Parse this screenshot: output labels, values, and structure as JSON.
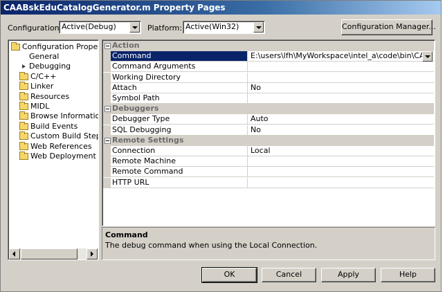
{
  "window": {
    "title": "CAABskEduCatalogGenerator.m Property Pages"
  },
  "toolbar": {
    "configuration_label": "Configuration:",
    "configuration_value": "Active(Debug)",
    "platform_label": "Platform:",
    "platform_value": "Active(Win32)",
    "config_manager_button": "Configuration Manager..."
  },
  "tree": {
    "root": "Configuration Properties",
    "items": [
      {
        "label": "General",
        "icon": "none"
      },
      {
        "label": "Debugging",
        "icon": "arrow-icon"
      },
      {
        "label": "C/C++",
        "icon": "folder-icon"
      },
      {
        "label": "Linker",
        "icon": "folder-icon"
      },
      {
        "label": "Resources",
        "icon": "folder-icon"
      },
      {
        "label": "MIDL",
        "icon": "folder-icon"
      },
      {
        "label": "Browse Information",
        "icon": "folder-icon"
      },
      {
        "label": "Build Events",
        "icon": "folder-icon"
      },
      {
        "label": "Custom Build Step",
        "icon": "folder-icon"
      },
      {
        "label": "Web References",
        "icon": "folder-icon"
      },
      {
        "label": "Web Deployment",
        "icon": "folder-icon"
      }
    ]
  },
  "grid": {
    "categories": [
      {
        "name": "Action",
        "properties": [
          {
            "name": "Command",
            "value": "E:\\users\\lfh\\MyWorkspace\\intel_a\\code\\bin\\CAABskEdu"
          },
          {
            "name": "Command Arguments",
            "value": ""
          },
          {
            "name": "Working Directory",
            "value": ""
          },
          {
            "name": "Attach",
            "value": "No"
          },
          {
            "name": "Symbol Path",
            "value": ""
          }
        ]
      },
      {
        "name": "Debuggers",
        "properties": [
          {
            "name": "Debugger Type",
            "value": "Auto"
          },
          {
            "name": "SQL Debugging",
            "value": "No"
          }
        ]
      },
      {
        "name": "Remote Settings",
        "properties": [
          {
            "name": "Connection",
            "value": "Local"
          },
          {
            "name": "Remote Machine",
            "value": ""
          },
          {
            "name": "Remote Command",
            "value": ""
          },
          {
            "name": "HTTP URL",
            "value": ""
          }
        ]
      }
    ]
  },
  "description": {
    "title": "Command",
    "text": "The debug command when using the Local Connection."
  },
  "buttons": {
    "ok": "OK",
    "cancel": "Cancel",
    "apply": "Apply",
    "help": "Help"
  },
  "colors": {
    "titlebar": "#0a246a",
    "selection": "#0a246a",
    "face": "#d4d0c8"
  }
}
